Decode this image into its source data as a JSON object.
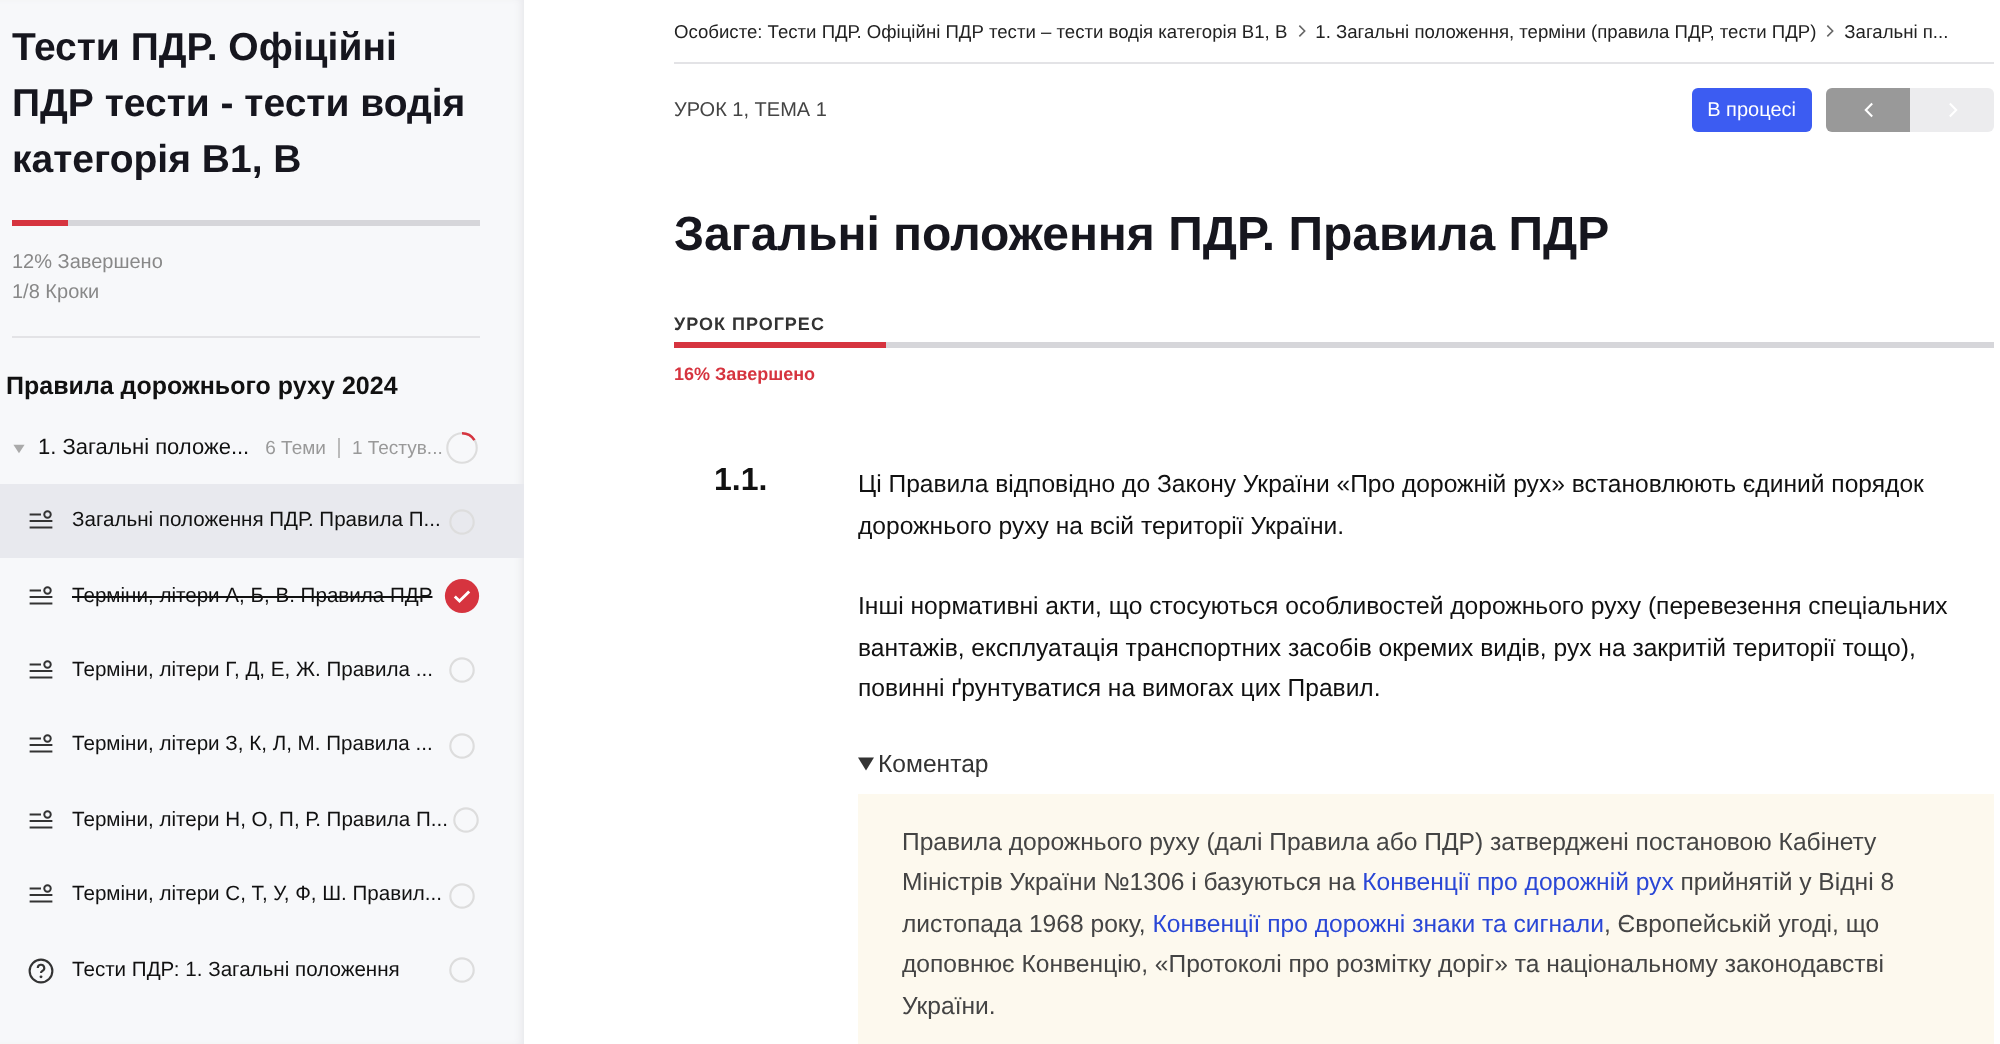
{
  "sidebar": {
    "course_title": "Тести ПДР. Офіційні ПДР тести - тести водія категорія B1, B",
    "progress": {
      "level": 0.12,
      "percent_text": "12% Завершено",
      "steps_text": "1/8 Кроки"
    },
    "section_title": "Правила дорожнього руху 2024",
    "lesson": {
      "title": "1. Загальні положе...",
      "topics_count": "6 Теми",
      "tests_count": "1 Тестув...",
      "expanded": true,
      "items": [
        {
          "kind": "topic",
          "label": "Загальні положення ПДР. Правила П...",
          "completed": false,
          "selected": true
        },
        {
          "kind": "topic",
          "label": "Терміни, літери А, Б, В. Правила ПДР",
          "completed": true,
          "selected": false
        },
        {
          "kind": "topic",
          "label": "Терміни, літери Г, Д, Е, Ж. Правила ...",
          "completed": false,
          "selected": false
        },
        {
          "kind": "topic",
          "label": "Терміни, літери З, К, Л, М. Правила ...",
          "completed": false,
          "selected": false
        },
        {
          "kind": "topic",
          "label": "Терміни, літери Н, О, П, Р. Правила П...",
          "completed": false,
          "selected": false
        },
        {
          "kind": "topic",
          "label": "Терміни, літери С, Т, У, Ф, Ш. Правил...",
          "completed": false,
          "selected": false
        },
        {
          "kind": "quiz",
          "label": "Тести ПДР: 1. Загальні положення",
          "completed": false,
          "selected": false
        }
      ]
    }
  },
  "breadcrumbs": [
    "Особисте: Тести ПДР. Офіційні ПДР тести – тести водія категорія B1, B",
    "1. Загальні положення, терміни (правила ПДР, тести ПДР)",
    "Загальні п..."
  ],
  "lesson_header": {
    "label": "УРОК 1, ТЕМА 1",
    "status_button": "В процесі",
    "prev_disabled": false,
    "next_disabled": true
  },
  "title": "Загальні положення ПДР. Правила ПДР",
  "lesson_progress": {
    "label": "УРОК ПРОГРЕС",
    "level": 0.16,
    "percent_text": "16% Завершено"
  },
  "article": {
    "number": "1.1.",
    "paragraphs": [
      "Ці Правила відповідно до Закону України «Про дорожній рух» встановлюють єдиний порядок дорожнього руху на всій території України.",
      "Інші нормативні акти, що стосуються особливостей дорожнього руху (перевезення спеціальних вантажів, експлуатація транспортних засобів окремих видів, рух на закритій території тощо), повинні ґрунтуватися на вимогах цих Правил."
    ],
    "comment": {
      "summary": "Коментар",
      "expanded": true,
      "segments": [
        {
          "text": "Правила дорожнього руху (далі Правила або ПДР) затверджені постановою Кабінету Міністрів України №1306 і базуються на ",
          "link": false
        },
        {
          "text": "Конвенції про дорожній рух",
          "link": true
        },
        {
          "text": " прийнятій у Відні 8 листопада 1968 року, ",
          "link": false
        },
        {
          "text": "Конвенції про дорожні знаки та сигнали",
          "link": true
        },
        {
          "text": ", Європейській угоді, що доповнює Конвенцію, «Протоколі про розмітку доріг» та національному законодавстві України.",
          "link": false
        }
      ]
    }
  }
}
